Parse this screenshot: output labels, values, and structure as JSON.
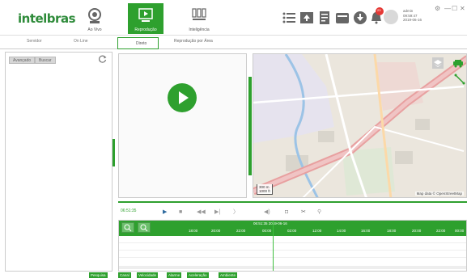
{
  "app": {
    "logo": "intelbras"
  },
  "nav": [
    {
      "label": "Ao Vivo",
      "icon": "webcam-icon"
    },
    {
      "label": "Reprodução",
      "icon": "playback-icon"
    },
    {
      "label": "Inteligência",
      "icon": "intelligence-icon"
    }
  ],
  "toolbar": {
    "notification_count": "23"
  },
  "user": {
    "name": "admin",
    "id": "09:59:47",
    "date": "2019-06-16"
  },
  "window": {
    "settings": "⚙",
    "minimize": "—",
    "maximize": "☐",
    "close": "✕"
  },
  "subtabs": {
    "device": "Servidor",
    "online": "On Line",
    "direct": "Direto",
    "area": "Reprodução por Área"
  },
  "left": {
    "btn_advanced": "Avançado",
    "btn_search": "Buscar"
  },
  "map": {
    "attribution": "Map data © OpenStreetMap",
    "scale_top": "300 m",
    "scale_bottom": "1000 ft"
  },
  "controls": {
    "time": "06:51:35"
  },
  "timeline": {
    "current": "06:51:35 2019-06-16",
    "ticks": [
      "18:00",
      "20:00",
      "22:00",
      "00:00",
      "02:00",
      "12:00",
      "14:00",
      "16:00",
      "18:00",
      "20:00",
      "22:00",
      "00:00"
    ]
  },
  "filters": [
    "Pesquisa",
    "Canal",
    "Velocidade",
    "Alarme",
    "Aceleração",
    "Ambiente"
  ],
  "colors": {
    "accent": "#2ea02e"
  }
}
